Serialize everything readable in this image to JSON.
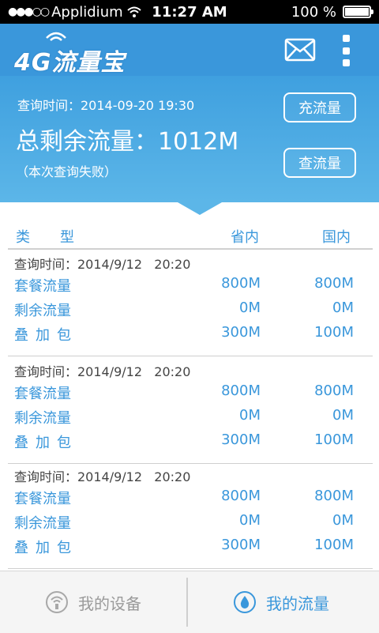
{
  "status_bar": {
    "carrier": "Applidium",
    "time": "11:27 AM",
    "battery_text": "100 %",
    "battery_level": 1.0
  },
  "header": {
    "logo_text": "4G流量宝",
    "mail_icon": "mail-icon",
    "more_icon": "more-vertical-icon"
  },
  "summary": {
    "query_time": "查询时间：2014-09-20 19:30",
    "total_label": "总剩余流量：",
    "total_value": "1012M",
    "status_note": "（本次查询失败）",
    "recharge_button": "充流量",
    "query_button": "查流量"
  },
  "table": {
    "headers": {
      "type": "类型",
      "province": "省内",
      "national": "国内"
    },
    "groups": [
      {
        "time": "查询时间：2014/9/12   20:20",
        "rows": [
          {
            "name": "套餐流量",
            "province": "800M",
            "national": "800M"
          },
          {
            "name": "剩余流量",
            "province": "0M",
            "national": "0M"
          },
          {
            "name": "叠加包",
            "province": "300M",
            "national": "100M"
          }
        ]
      },
      {
        "time": "查询时间：2014/9/12   20:20",
        "rows": [
          {
            "name": "套餐流量",
            "province": "800M",
            "national": "800M"
          },
          {
            "name": "剩余流量",
            "province": "0M",
            "national": "0M"
          },
          {
            "name": "叠加包",
            "province": "300M",
            "national": "100M"
          }
        ]
      },
      {
        "time": "查询时间：2014/9/12   20:20",
        "rows": [
          {
            "name": "套餐流量",
            "province": "800M",
            "national": "800M"
          },
          {
            "name": "剩余流量",
            "province": "0M",
            "national": "0M"
          },
          {
            "name": "叠加包",
            "province": "300M",
            "national": "100M"
          }
        ]
      }
    ]
  },
  "bottom_nav": {
    "items": [
      {
        "label": "我的设备",
        "icon": "device-signal-icon",
        "active": false
      },
      {
        "label": "我的流量",
        "icon": "water-drop-icon",
        "active": true
      }
    ]
  },
  "colors": {
    "primary": "#3a97db",
    "banner_bottom": "#5cb6e8",
    "inactive": "#9a9a9a"
  }
}
